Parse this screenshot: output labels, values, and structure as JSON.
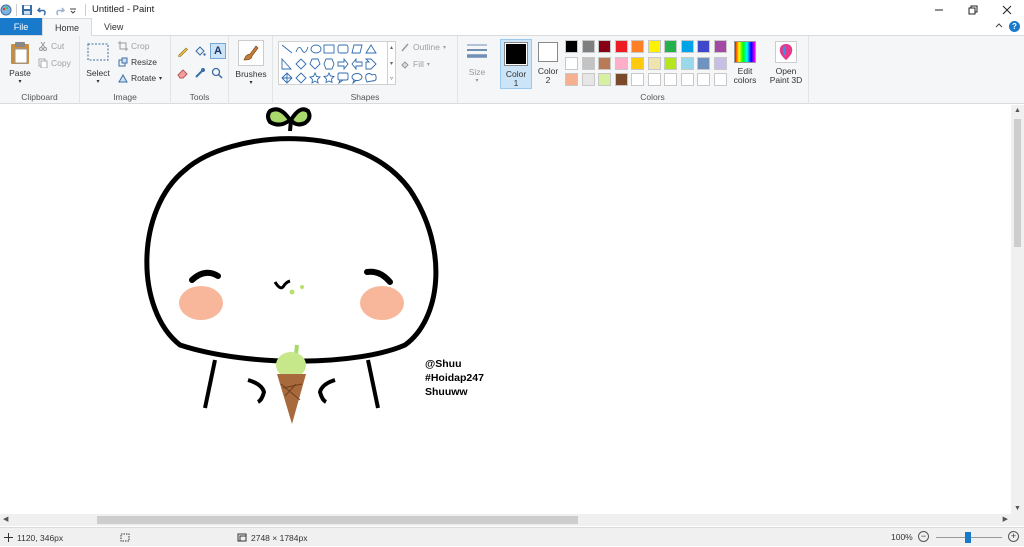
{
  "window": {
    "title": "Untitled - Paint"
  },
  "tabs": {
    "file": "File",
    "home": "Home",
    "view": "View"
  },
  "clipboard": {
    "paste": "Paste",
    "cut": "Cut",
    "copy": "Copy",
    "label": "Clipboard"
  },
  "image": {
    "select": "Select",
    "crop": "Crop",
    "resize": "Resize",
    "rotate": "Rotate",
    "label": "Image"
  },
  "tools": {
    "label": "Tools"
  },
  "brushes": {
    "label": "Brushes"
  },
  "shapes": {
    "outline": "Outline",
    "fill": "Fill",
    "label": "Shapes"
  },
  "size": {
    "label": "Size"
  },
  "colors": {
    "color1_label": "Color",
    "color1_num": "1",
    "color2_label": "Color",
    "color2_num": "2",
    "edit_label": "Edit",
    "edit_label2": "colors",
    "paint3d_label": "Open",
    "paint3d_label2": "Paint 3D",
    "label": "Colors",
    "color1": "#000000",
    "color2": "#ffffff",
    "palette_row1": [
      "#000000",
      "#7f7f7f",
      "#880015",
      "#ed1c24",
      "#ff7f27",
      "#fff200",
      "#22b14c",
      "#00a2e8",
      "#3f48cc",
      "#a349a4"
    ],
    "palette_row2": [
      "#ffffff",
      "#c3c3c3",
      "#b97a57",
      "#ffaec9",
      "#ffc90e",
      "#efe4b0",
      "#b5e61d",
      "#99d9ea",
      "#7092be",
      "#c8bfe7"
    ],
    "palette_row3": [
      "#f5b090",
      "#e6e6e6",
      "#d5f0a0",
      "#7a4a2a",
      "#ffffff",
      "#ffffff",
      "#ffffff",
      "#ffffff",
      "#ffffff",
      "#ffffff"
    ]
  },
  "drawing": {
    "text_line1": "@Shuu",
    "text_line2": "#Hoidap247",
    "text_line3": "Shuuww"
  },
  "status": {
    "cursor_pos": "1120, 346px",
    "image_size": "2748 × 1784px",
    "zoom": "100%"
  }
}
